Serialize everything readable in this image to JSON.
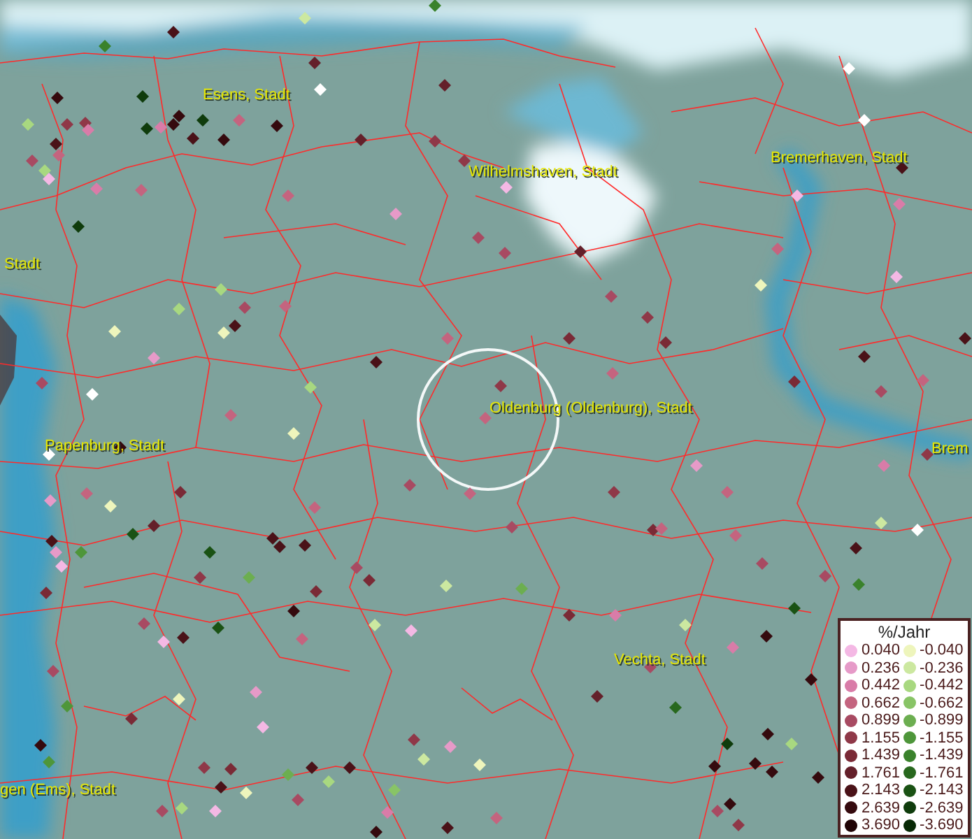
{
  "map": {
    "place_labels": [
      {
        "text": "Esens, Stadt"
      },
      {
        "text": "Wilhelmshaven, Stadt"
      },
      {
        "text": "Bremerhaven, Stadt"
      },
      {
        "text": "Stadt"
      },
      {
        "text": "Oldenburg (Oldenburg), Stadt"
      },
      {
        "text": "Papenburg, Stadt"
      },
      {
        "text": "Brem"
      },
      {
        "text": "Vechta, Stadt"
      },
      {
        "text": "gen (Ems), Stadt"
      }
    ],
    "markers": [
      {
        "color": "#4a1218"
      },
      {
        "color": "#3a822c"
      },
      {
        "color": "#cce8a0"
      },
      {
        "color": "#3a822c"
      },
      {
        "color": "#64202a"
      },
      {
        "color": "#350a0e"
      },
      {
        "color": "#0f3c0c"
      },
      {
        "color": "#8f3848"
      },
      {
        "color": "#a8d880"
      },
      {
        "color": "#8f3848"
      },
      {
        "color": "#d97ca8"
      },
      {
        "color": "#4a1218"
      },
      {
        "color": "#a84a62"
      },
      {
        "color": "#a8d880"
      },
      {
        "color": "#c4647f"
      },
      {
        "color": "#f4b8e4"
      },
      {
        "color": "#d97ca8"
      },
      {
        "color": "#0f3c0c"
      },
      {
        "color": "#350a0e"
      },
      {
        "color": "#350a0e"
      },
      {
        "color": "#0f3c0c"
      },
      {
        "color": "#c4647f"
      },
      {
        "color": "#0f3c0c"
      },
      {
        "color": "#d97ca8"
      },
      {
        "color": "#4a1218"
      },
      {
        "color": "#350a0e"
      },
      {
        "color": "#350a0e"
      },
      {
        "color": "#ffffff"
      },
      {
        "color": "#64202a"
      },
      {
        "color": "#64202a"
      },
      {
        "color": "#8f3848"
      },
      {
        "color": "#8f3848"
      },
      {
        "color": "#f4b8e4"
      },
      {
        "color": "#a84a62"
      },
      {
        "color": "#a84a62"
      },
      {
        "color": "#64202a"
      },
      {
        "color": "#e69ac8"
      },
      {
        "color": "#c4647f"
      },
      {
        "color": "#c4647f"
      },
      {
        "color": "#ffffff"
      },
      {
        "color": "#ffffff"
      },
      {
        "color": "#4a1218"
      },
      {
        "color": "#f4b8e4"
      },
      {
        "color": "#d97ca8"
      },
      {
        "color": "#c4647f"
      },
      {
        "color": "#eef5bc"
      },
      {
        "color": "#f4b8e4"
      },
      {
        "color": "#4a1218"
      },
      {
        "color": "#7a2a36"
      },
      {
        "color": "#a84a62"
      },
      {
        "color": "#c4647f"
      },
      {
        "color": "#4a1218"
      },
      {
        "color": "#d97ca8"
      },
      {
        "color": "#8f3848"
      },
      {
        "color": "#cce8a0"
      },
      {
        "color": "#3a822c"
      },
      {
        "color": "#ffffff"
      },
      {
        "color": "#4a1218"
      },
      {
        "color": "#a84a62"
      },
      {
        "color": "#1a5214"
      },
      {
        "color": "#a84a62"
      },
      {
        "color": "#c4647f"
      },
      {
        "color": "#e69ac8"
      },
      {
        "color": "#c4647f"
      },
      {
        "color": "#7a2a36"
      },
      {
        "color": "#8f3848"
      },
      {
        "color": "#c4647f"
      },
      {
        "color": "#7a2a36"
      },
      {
        "color": "#a84a62"
      },
      {
        "color": "#8f3848"
      },
      {
        "color": "#7a2a36"
      },
      {
        "color": "#c4647f"
      },
      {
        "color": "#8f3848"
      },
      {
        "color": "#c4647f"
      },
      {
        "color": "#a84a62"
      },
      {
        "color": "#c4647f"
      },
      {
        "color": "#a84a62"
      },
      {
        "color": "#4a1218"
      },
      {
        "color": "#a8d880"
      },
      {
        "color": "#eef5bc"
      },
      {
        "color": "#c4647f"
      },
      {
        "color": "#eef5bc"
      },
      {
        "color": "#4a1218"
      },
      {
        "color": "#a84a62"
      },
      {
        "color": "#c4647f"
      },
      {
        "color": "#a8d880"
      },
      {
        "color": "#a8d880"
      },
      {
        "color": "#e69ac8"
      },
      {
        "color": "#eef5bc"
      },
      {
        "color": "#a84a62"
      },
      {
        "color": "#ffffff"
      },
      {
        "color": "#ffffff"
      },
      {
        "color": "#350a0e"
      },
      {
        "color": "#7a2a36"
      },
      {
        "color": "#64202a"
      },
      {
        "color": "#e69ac8"
      },
      {
        "color": "#c4647f"
      },
      {
        "color": "#eef5bc"
      },
      {
        "color": "#e69ac8"
      },
      {
        "color": "#4e963a"
      },
      {
        "color": "#4a1218"
      },
      {
        "color": "#f4b8e4"
      },
      {
        "color": "#7a2a36"
      },
      {
        "color": "#1a5214"
      },
      {
        "color": "#1a5214"
      },
      {
        "color": "#8f3848"
      },
      {
        "color": "#a84a62"
      },
      {
        "color": "#f4b8e4"
      },
      {
        "color": "#4a1218"
      },
      {
        "color": "#1a5214"
      },
      {
        "color": "#6cae50"
      },
      {
        "color": "#4a1218"
      },
      {
        "color": "#c4647f"
      },
      {
        "color": "#4a1218"
      },
      {
        "color": "#4a1218"
      },
      {
        "color": "#a84a62"
      },
      {
        "color": "#7a2a36"
      },
      {
        "color": "#7a2a36"
      },
      {
        "color": "#350a0e"
      },
      {
        "color": "#c4647f"
      },
      {
        "color": "#cce8a0"
      },
      {
        "color": "#cce8a0"
      },
      {
        "color": "#6cae50"
      },
      {
        "color": "#f4b8e4"
      },
      {
        "color": "#8f3848"
      },
      {
        "color": "#cce8a0"
      },
      {
        "color": "#e69ac8"
      },
      {
        "color": "#eef5bc"
      },
      {
        "color": "#88c466"
      },
      {
        "color": "#d97ca8"
      },
      {
        "color": "#4a1218"
      },
      {
        "color": "#4a1218"
      },
      {
        "color": "#a8d880"
      },
      {
        "color": "#6cae50"
      },
      {
        "color": "#e69ac8"
      },
      {
        "color": "#f4b8e4"
      },
      {
        "color": "#eef5bc"
      },
      {
        "color": "#4a1218"
      },
      {
        "color": "#f4b8e4"
      },
      {
        "color": "#a8d880"
      },
      {
        "color": "#a84a62"
      },
      {
        "color": "#8f3848"
      },
      {
        "color": "#7a2a36"
      },
      {
        "color": "#eef5bc"
      },
      {
        "color": "#7a2a36"
      },
      {
        "color": "#4e963a"
      },
      {
        "color": "#350a0e"
      },
      {
        "color": "#4e963a"
      },
      {
        "color": "#a84a62"
      },
      {
        "color": "#a84a62"
      },
      {
        "color": "#350a0e"
      },
      {
        "color": "#4a1218"
      },
      {
        "color": "#c4647f"
      },
      {
        "color": "#7a2a36"
      },
      {
        "color": "#d97ca8"
      },
      {
        "color": "#c4647f"
      },
      {
        "color": "#cce8a0"
      },
      {
        "color": "#d97ca8"
      },
      {
        "color": "#350a0e"
      },
      {
        "color": "#a8d880"
      },
      {
        "color": "#350a0e"
      },
      {
        "color": "#350a0e"
      },
      {
        "color": "#350a0e"
      },
      {
        "color": "#350a0e"
      },
      {
        "color": "#350a0e"
      },
      {
        "color": "#0f3c0c"
      },
      {
        "color": "#350a0e"
      },
      {
        "color": "#a84a62"
      },
      {
        "color": "#8f3848"
      },
      {
        "color": "#350a0e"
      },
      {
        "color": "#64202a"
      },
      {
        "color": "#28681e"
      },
      {
        "color": "#a84a62"
      }
    ]
  },
  "legend": {
    "title": "%/Jahr",
    "positive": [
      {
        "color": "#f4b8e4",
        "label": "0.040"
      },
      {
        "color": "#e69ac8",
        "label": "0.236"
      },
      {
        "color": "#d97ca8",
        "label": "0.442"
      },
      {
        "color": "#c4647f",
        "label": "0.662"
      },
      {
        "color": "#a84a62",
        "label": "0.899"
      },
      {
        "color": "#8f3848",
        "label": "1.155"
      },
      {
        "color": "#7a2a36",
        "label": "1.439"
      },
      {
        "color": "#64202a",
        "label": "1.761"
      },
      {
        "color": "#4a1218",
        "label": "2.143"
      },
      {
        "color": "#350a0e",
        "label": "2.639"
      },
      {
        "color": "#200406",
        "label": "3.690"
      }
    ],
    "negative": [
      {
        "color": "#eef5bc",
        "label": "-0.040"
      },
      {
        "color": "#cce8a0",
        "label": "-0.236"
      },
      {
        "color": "#a8d880",
        "label": "-0.442"
      },
      {
        "color": "#88c466",
        "label": "-0.662"
      },
      {
        "color": "#6cae50",
        "label": "-0.899"
      },
      {
        "color": "#4e963a",
        "label": "-1.155"
      },
      {
        "color": "#3a822c",
        "label": "-1.439"
      },
      {
        "color": "#28681e",
        "label": "-1.761"
      },
      {
        "color": "#1a5214",
        "label": "-2.143"
      },
      {
        "color": "#0f3c0c",
        "label": "-2.639"
      },
      {
        "color": "#082a06",
        "label": "-3.690"
      }
    ]
  }
}
